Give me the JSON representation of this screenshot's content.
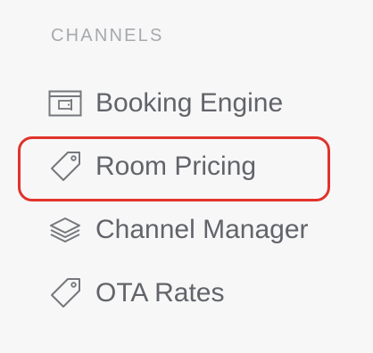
{
  "sidebar": {
    "section_title": "CHANNELS",
    "items": [
      {
        "label": "Booking Engine",
        "icon": "booking-engine-icon"
      },
      {
        "label": "Room Pricing",
        "icon": "price-tag-icon"
      },
      {
        "label": "Channel Manager",
        "icon": "layers-icon"
      },
      {
        "label": "OTA Rates",
        "icon": "price-tag-icon"
      }
    ],
    "highlighted_item": "Room Pricing",
    "highlight_color": "#e0332b"
  }
}
